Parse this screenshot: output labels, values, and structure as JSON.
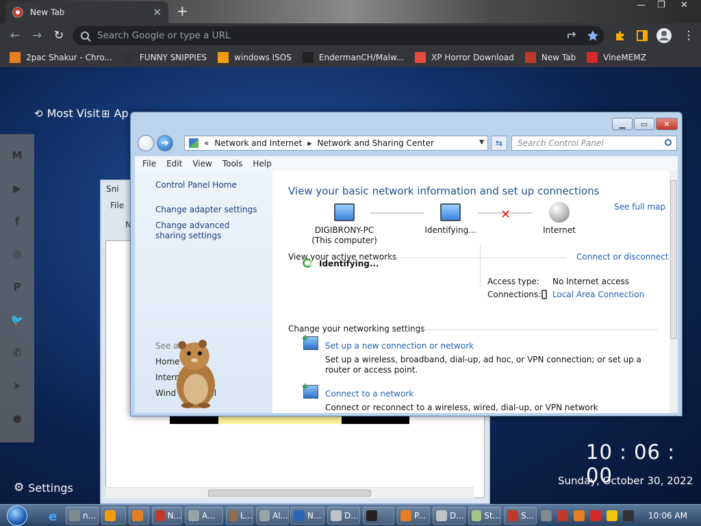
{
  "browser": {
    "tab_title": "New Tab",
    "omnibox_placeholder": "Search Google or type a URL",
    "bookmarks": [
      {
        "label": "2pac Shakur - Chro...",
        "icon": "cart-icon",
        "color": "#e67e22"
      },
      {
        "label": "FUNNY SNIPPIES",
        "icon": "h-logo-icon",
        "color": "#333333"
      },
      {
        "label": "windows ISOS",
        "icon": "ph-logo-icon",
        "color": "#f39c12"
      },
      {
        "label": "EndermanCH/Malw...",
        "icon": "yp-logo-icon",
        "color": "#222222"
      },
      {
        "label": "XP Horror Download",
        "icon": "x-logo-icon",
        "color": "#e74c3c"
      },
      {
        "label": "New Tab",
        "icon": "chrome-icon",
        "color": "#c0392b"
      },
      {
        "label": "VineMEMZ",
        "icon": "r-logo-icon",
        "color": "#d62828"
      }
    ]
  },
  "newtab": {
    "most_visited": "Most Visit",
    "apps": "Ap",
    "settings": "Settings",
    "clock": "10 : 06 : 00",
    "date": "Sunday, October 30, 2022",
    "social": [
      "gmail-icon",
      "youtube-icon",
      "facebook-icon",
      "instagram-icon",
      "pinterest-icon",
      "twitter-icon",
      "whatsapp-icon",
      "telegram-icon",
      "reddit-icon"
    ]
  },
  "bg_window": {
    "title": "Sni",
    "menu_file": "File",
    "menu_n": "N"
  },
  "control_panel": {
    "breadcrumb": {
      "sep": "«",
      "part1": "Network and Internet",
      "part2": "Network and Sharing Center"
    },
    "search_placeholder": "Search Control Panel",
    "menu": {
      "file": "File",
      "edit": "Edit",
      "view": "View",
      "tools": "Tools",
      "help": "Help"
    },
    "left": {
      "home": "Control Panel Home",
      "adapter": "Change adapter settings",
      "advanced": "Change advanced sharing settings",
      "see_also": "See al",
      "item1": "Home",
      "item2": "Intern",
      "item3": "Wind",
      "item3b": "all"
    },
    "headline": "View your basic network information and set up connections",
    "see_full_map": "See full map",
    "nodes": {
      "pc": "DIGIBRONY-PC",
      "pc_sub": "(This computer)",
      "ident": "Identifying...",
      "internet": "Internet"
    },
    "active_networks": "View your active networks",
    "connect_disconnect": "Connect or disconnect",
    "network_status": "Identifying...",
    "access_type_label": "Access type:",
    "access_type_value": "No Internet access",
    "connections_label": "Connections:",
    "connections_value": "Local Area Connection",
    "change_settings": "Change your networking settings",
    "tasks": [
      {
        "title": "Set up a new connection or network",
        "desc": "Set up a wireless, broadband, dial-up, ad hoc, or VPN connection; or set up a router or access point."
      },
      {
        "title": "Connect to a network",
        "desc": "Connect or reconnect to a wireless, wired, dial-up, or VPN network connection."
      }
    ]
  },
  "taskbar": {
    "buttons": [
      {
        "label": "n...",
        "color": "#7f8c8d"
      },
      {
        "label": "",
        "color": "#f39c12"
      },
      {
        "label": "",
        "color": "#e67e22"
      },
      {
        "label": "N...",
        "color": "#c0392b"
      },
      {
        "label": "A...",
        "color": "#95a5a6"
      },
      {
        "label": "L...",
        "color": "#8e6e4e"
      },
      {
        "label": "Al...",
        "color": "#95a5a6"
      },
      {
        "label": "N...",
        "color": "#2966b8"
      },
      {
        "label": "D...",
        "color": "#bdc3c7"
      },
      {
        "label": "",
        "color": "#222222"
      },
      {
        "label": "P...",
        "color": "#e67e22"
      },
      {
        "label": "D...",
        "color": "#bdc3c7"
      },
      {
        "label": "St...",
        "color": "#a3c585"
      },
      {
        "label": "S...",
        "color": "#c0392b"
      }
    ],
    "time": "10:06 AM"
  }
}
